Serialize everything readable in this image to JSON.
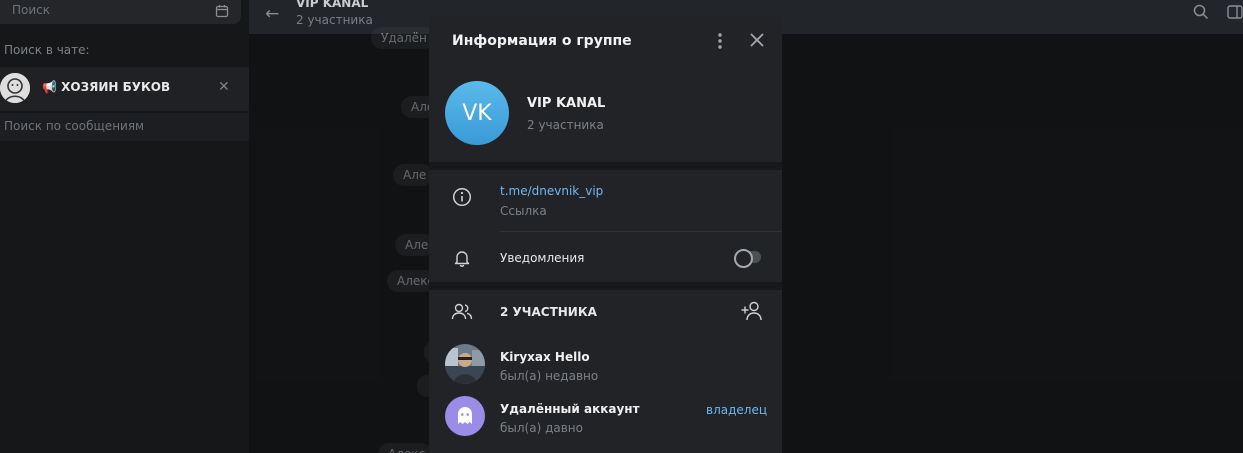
{
  "sidebar": {
    "search_placeholder": "Поиск",
    "in_chat_label": "Поиск в чате:",
    "chat_chip_label": "📢 ХОЗЯИН БУКОВ",
    "close_glyph": "✕",
    "message_search_placeholder": "Поиск по сообщениям"
  },
  "chat": {
    "title": "VIP KANAL",
    "subtitle": "2 участника",
    "back_glyph": "←",
    "pills": [
      "Удалён",
      "Але",
      "Але",
      "Але",
      "Алекс",
      "",
      "",
      "Алекс"
    ]
  },
  "modal": {
    "title": "Информация о группе",
    "close_glyph": "✕",
    "group": {
      "avatar_initials": "VK",
      "name": "VIP KANAL",
      "members": "2 участника",
      "avatar_color": "#4aa9e0"
    },
    "link": {
      "value": "t.me/dnevnik_vip",
      "label": "Ссылка"
    },
    "notifications": {
      "label": "Уведомления",
      "enabled": false
    },
    "members_header": "2 УЧАСТНИКА",
    "members": [
      {
        "name": "Kiryxax Hello",
        "status": "был(а) недавно",
        "role": ""
      },
      {
        "name": "Удалённый аккаунт",
        "status": "был(а) давно",
        "role": "владелец"
      }
    ]
  },
  "colors": {
    "accent_link": "#71b6f0",
    "modal_bg": "#212327",
    "deleted_avatar": "#9b8ce8"
  }
}
